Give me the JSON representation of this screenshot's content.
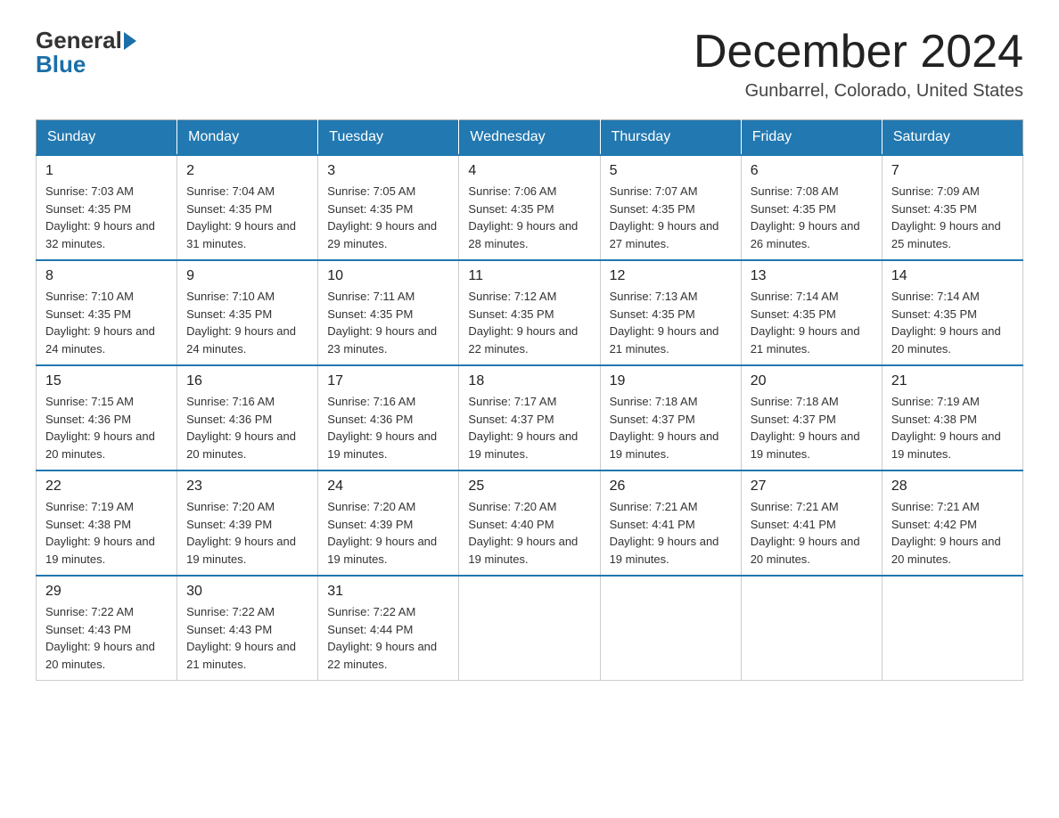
{
  "header": {
    "logo": {
      "general": "General",
      "blue": "Blue"
    },
    "title": "December 2024",
    "location": "Gunbarrel, Colorado, United States"
  },
  "weekdays": [
    "Sunday",
    "Monday",
    "Tuesday",
    "Wednesday",
    "Thursday",
    "Friday",
    "Saturday"
  ],
  "weeks": [
    [
      {
        "day": 1,
        "sunrise": "7:03 AM",
        "sunset": "4:35 PM",
        "daylight": "9 hours and 32 minutes."
      },
      {
        "day": 2,
        "sunrise": "7:04 AM",
        "sunset": "4:35 PM",
        "daylight": "9 hours and 31 minutes."
      },
      {
        "day": 3,
        "sunrise": "7:05 AM",
        "sunset": "4:35 PM",
        "daylight": "9 hours and 29 minutes."
      },
      {
        "day": 4,
        "sunrise": "7:06 AM",
        "sunset": "4:35 PM",
        "daylight": "9 hours and 28 minutes."
      },
      {
        "day": 5,
        "sunrise": "7:07 AM",
        "sunset": "4:35 PM",
        "daylight": "9 hours and 27 minutes."
      },
      {
        "day": 6,
        "sunrise": "7:08 AM",
        "sunset": "4:35 PM",
        "daylight": "9 hours and 26 minutes."
      },
      {
        "day": 7,
        "sunrise": "7:09 AM",
        "sunset": "4:35 PM",
        "daylight": "9 hours and 25 minutes."
      }
    ],
    [
      {
        "day": 8,
        "sunrise": "7:10 AM",
        "sunset": "4:35 PM",
        "daylight": "9 hours and 24 minutes."
      },
      {
        "day": 9,
        "sunrise": "7:10 AM",
        "sunset": "4:35 PM",
        "daylight": "9 hours and 24 minutes."
      },
      {
        "day": 10,
        "sunrise": "7:11 AM",
        "sunset": "4:35 PM",
        "daylight": "9 hours and 23 minutes."
      },
      {
        "day": 11,
        "sunrise": "7:12 AM",
        "sunset": "4:35 PM",
        "daylight": "9 hours and 22 minutes."
      },
      {
        "day": 12,
        "sunrise": "7:13 AM",
        "sunset": "4:35 PM",
        "daylight": "9 hours and 21 minutes."
      },
      {
        "day": 13,
        "sunrise": "7:14 AM",
        "sunset": "4:35 PM",
        "daylight": "9 hours and 21 minutes."
      },
      {
        "day": 14,
        "sunrise": "7:14 AM",
        "sunset": "4:35 PM",
        "daylight": "9 hours and 20 minutes."
      }
    ],
    [
      {
        "day": 15,
        "sunrise": "7:15 AM",
        "sunset": "4:36 PM",
        "daylight": "9 hours and 20 minutes."
      },
      {
        "day": 16,
        "sunrise": "7:16 AM",
        "sunset": "4:36 PM",
        "daylight": "9 hours and 20 minutes."
      },
      {
        "day": 17,
        "sunrise": "7:16 AM",
        "sunset": "4:36 PM",
        "daylight": "9 hours and 19 minutes."
      },
      {
        "day": 18,
        "sunrise": "7:17 AM",
        "sunset": "4:37 PM",
        "daylight": "9 hours and 19 minutes."
      },
      {
        "day": 19,
        "sunrise": "7:18 AM",
        "sunset": "4:37 PM",
        "daylight": "9 hours and 19 minutes."
      },
      {
        "day": 20,
        "sunrise": "7:18 AM",
        "sunset": "4:37 PM",
        "daylight": "9 hours and 19 minutes."
      },
      {
        "day": 21,
        "sunrise": "7:19 AM",
        "sunset": "4:38 PM",
        "daylight": "9 hours and 19 minutes."
      }
    ],
    [
      {
        "day": 22,
        "sunrise": "7:19 AM",
        "sunset": "4:38 PM",
        "daylight": "9 hours and 19 minutes."
      },
      {
        "day": 23,
        "sunrise": "7:20 AM",
        "sunset": "4:39 PM",
        "daylight": "9 hours and 19 minutes."
      },
      {
        "day": 24,
        "sunrise": "7:20 AM",
        "sunset": "4:39 PM",
        "daylight": "9 hours and 19 minutes."
      },
      {
        "day": 25,
        "sunrise": "7:20 AM",
        "sunset": "4:40 PM",
        "daylight": "9 hours and 19 minutes."
      },
      {
        "day": 26,
        "sunrise": "7:21 AM",
        "sunset": "4:41 PM",
        "daylight": "9 hours and 19 minutes."
      },
      {
        "day": 27,
        "sunrise": "7:21 AM",
        "sunset": "4:41 PM",
        "daylight": "9 hours and 20 minutes."
      },
      {
        "day": 28,
        "sunrise": "7:21 AM",
        "sunset": "4:42 PM",
        "daylight": "9 hours and 20 minutes."
      }
    ],
    [
      {
        "day": 29,
        "sunrise": "7:22 AM",
        "sunset": "4:43 PM",
        "daylight": "9 hours and 20 minutes."
      },
      {
        "day": 30,
        "sunrise": "7:22 AM",
        "sunset": "4:43 PM",
        "daylight": "9 hours and 21 minutes."
      },
      {
        "day": 31,
        "sunrise": "7:22 AM",
        "sunset": "4:44 PM",
        "daylight": "9 hours and 22 minutes."
      },
      null,
      null,
      null,
      null
    ]
  ]
}
